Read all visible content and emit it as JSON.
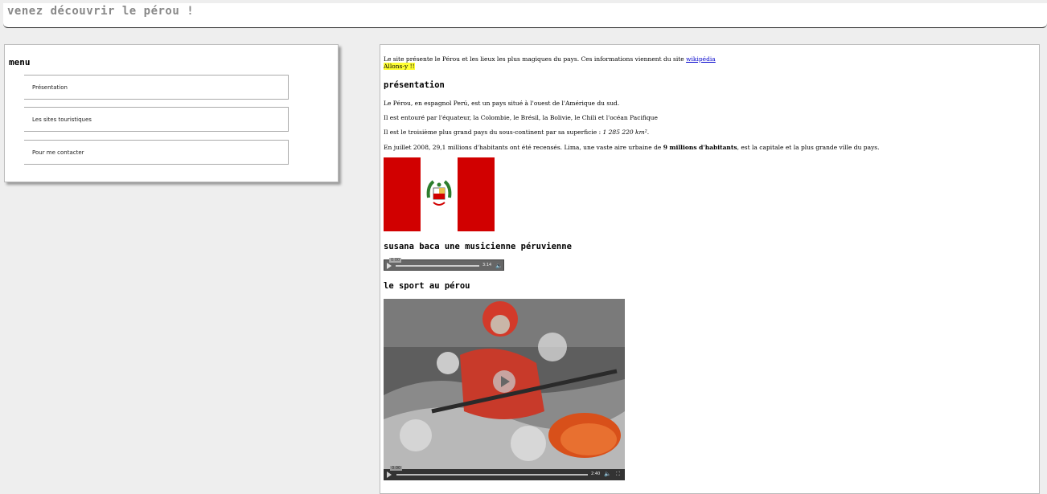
{
  "header": {
    "title": "venez découvrir le pérou !"
  },
  "menu": {
    "title": "menu",
    "items": [
      {
        "label": "Présentation"
      },
      {
        "label": "Les sites touristiques"
      },
      {
        "label": "Pour me contacter"
      }
    ]
  },
  "content": {
    "intro_text": "Le site présente le Pérou et les lieux les plus magiques du pays. Ces informations viennent du site ",
    "intro_link": "wikipédia",
    "allons": "Allons-y !!",
    "presentation_title": "présentation",
    "p1": "Le Pérou, en espagnol Perú, est un pays situé à l'ouest de l'Amérique du sud.",
    "p2": "Il est entouré par l'équateur, la Colombie, le Brésil, la Bolivie, le Chili et l'océan Pacifique",
    "p3_before": "Il est le troisième plus grand pays du sous-continent par sa superficie : ",
    "p3_em": "1 285 220 km².",
    "p4_before": "En juillet 2008, 29,1 millions d'habitants ont été recensés. Lima, une vaste aire urbaine de ",
    "p4_bold": "9 millions d'habitants",
    "p4_after": ", est la capitale et la plus grande ville du pays.",
    "music_title": "susana baca une musicienne péruvienne",
    "audio": {
      "current": "0:00",
      "duration": "3:14",
      "volume_icon": "speaker-icon"
    },
    "sport_title": "le sport au pérou",
    "video": {
      "current": "0:00",
      "duration": "2:40",
      "volume_icon": "speaker-icon",
      "fullscreen_icon": "fullscreen-icon"
    }
  },
  "colors": {
    "flag_red": "#d10000",
    "highlight": "#ffff33",
    "link": "#0000cc"
  }
}
